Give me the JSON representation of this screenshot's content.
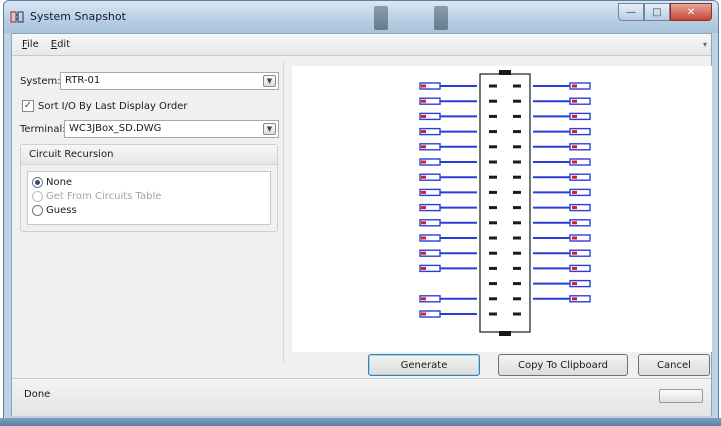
{
  "window": {
    "title": "System Snapshot"
  },
  "menu": {
    "file_first": "F",
    "file_rest": "ile",
    "edit_first": "E",
    "edit_rest": "dit"
  },
  "left": {
    "system_label": "System:",
    "system_value": "RTR-01",
    "sort_label": "Sort I/O By Last Display Order",
    "sort_checked": true,
    "terminal_label": "Terminal:",
    "terminal_value": "WC3JBox_SD.DWG",
    "group_title": "Circuit Recursion",
    "options": [
      {
        "label": "None",
        "selected": true,
        "enabled": true
      },
      {
        "label": "Get From Circuits Table",
        "selected": false,
        "enabled": false
      },
      {
        "label": "Guess",
        "selected": false,
        "enabled": true
      }
    ]
  },
  "buttons": {
    "generate": "Generate",
    "copy": "Copy To Clipboard",
    "cancel": "Cancel"
  },
  "status": {
    "text": "Done"
  },
  "colors": {
    "wire": "#2b3fd6",
    "tag": "#d21f2f",
    "frame": "#1a1a1a"
  },
  "diagram": {
    "rows": 16,
    "left_wires": [
      1,
      1,
      1,
      1,
      1,
      1,
      1,
      1,
      1,
      1,
      1,
      1,
      1,
      0,
      1,
      1
    ],
    "right_wires": [
      1,
      1,
      1,
      1,
      1,
      1,
      1,
      1,
      1,
      1,
      1,
      1,
      1,
      1,
      1,
      0
    ]
  }
}
